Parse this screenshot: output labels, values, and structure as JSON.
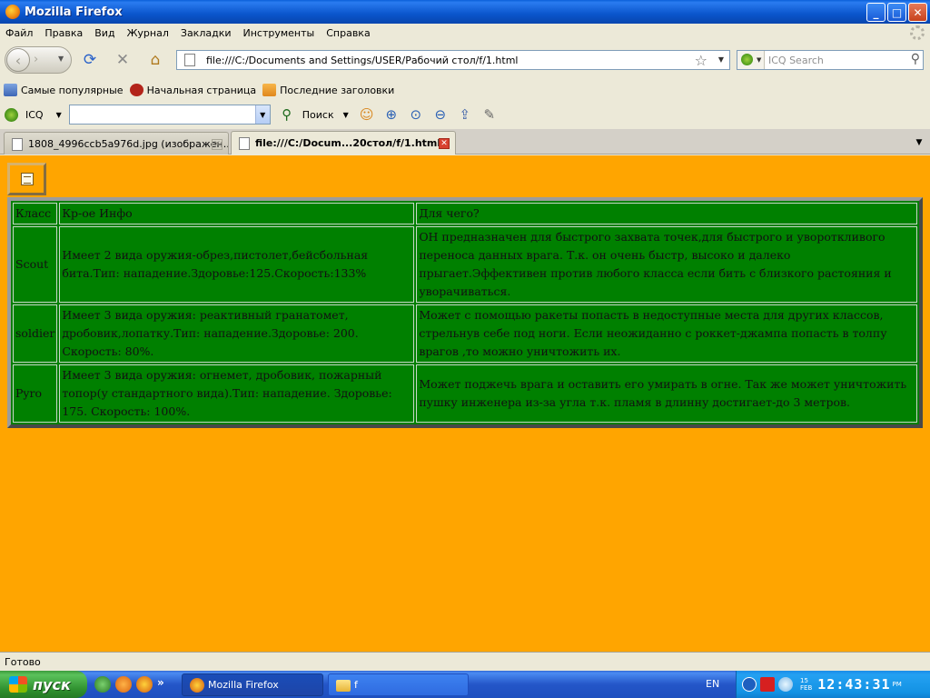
{
  "window": {
    "title": "Mozilla Firefox"
  },
  "menu": [
    "Файл",
    "Правка",
    "Вид",
    "Журнал",
    "Закладки",
    "Инструменты",
    "Справка"
  ],
  "navigation": {
    "url": "file:///C:/Documents and Settings/USER/Рабочий стол/f/1.html",
    "search_placeholder": "ICQ Search"
  },
  "bookmarks": [
    {
      "label": "Самые популярные",
      "icon": "most-visited-icon"
    },
    {
      "label": "Начальная страница",
      "icon": "start-page-icon"
    },
    {
      "label": "Последние заголовки",
      "icon": "rss-icon"
    }
  ],
  "icq_toolbar": {
    "label": "ICQ",
    "search_label": "Поиск"
  },
  "tabs": [
    {
      "label": "1808_4996ccb5a976d.jpg (изображен...",
      "active": false
    },
    {
      "label": "file:///C:/Docum...20стол/f/1.html",
      "active": true
    }
  ],
  "table": {
    "headers": [
      "Класс",
      "Кр-ое Инфо",
      "Для чего?"
    ],
    "rows": [
      {
        "class": "Scout",
        "info": "Имеет 2 вида оружия-обрез,пистолет,бейсбольная бита.Тип: нападение.Здоровье:125.Скорость:133%",
        "purpose": "ОН предназначен для быстрого захвата точек,для быстрого и увороткливого переноса данных врага. Т.к. он очень быстр, высоко и далеко прыгает.Эффективен против любого класса если бить с близкого растояния и уворачиваться."
      },
      {
        "class": "soldier",
        "info": "Имеет 3 вида оружия: реактивный гранатомет, дробовик,лопатку.Тип: нападение.Здоровье: 200. Скорость: 80%.",
        "purpose": "Может с помощью ракеты попасть в недоступные места для других классов, стрельнув себе под ноги. Если неожиданно с роккет-джампа попасть в толпу врагов ,то можно уничтожить их."
      },
      {
        "class": "Pyro",
        "info": "Имеет 3 вида оружия: огнемет, дробовик, пожарный топор(у стандартного вида).Тип: нападение. Здоровье: 175. Скорость: 100%.",
        "purpose": "Может поджечь врага и оставить его умирать в огне. Так же может уничтожить пушку инженера из-за угла т.к. пламя в длинну достигает-до 3 метров."
      }
    ]
  },
  "status": "Готово",
  "taskbar": {
    "start_label": "пуск",
    "tasks": [
      "Mozilla Firefox",
      "f"
    ],
    "lang": "EN",
    "date_day": "15",
    "date_month": "FEB",
    "time": "12:43:31",
    "ampm": "PM"
  },
  "colors": {
    "page_bg": "#ffa500",
    "table_bg": "#008000"
  }
}
